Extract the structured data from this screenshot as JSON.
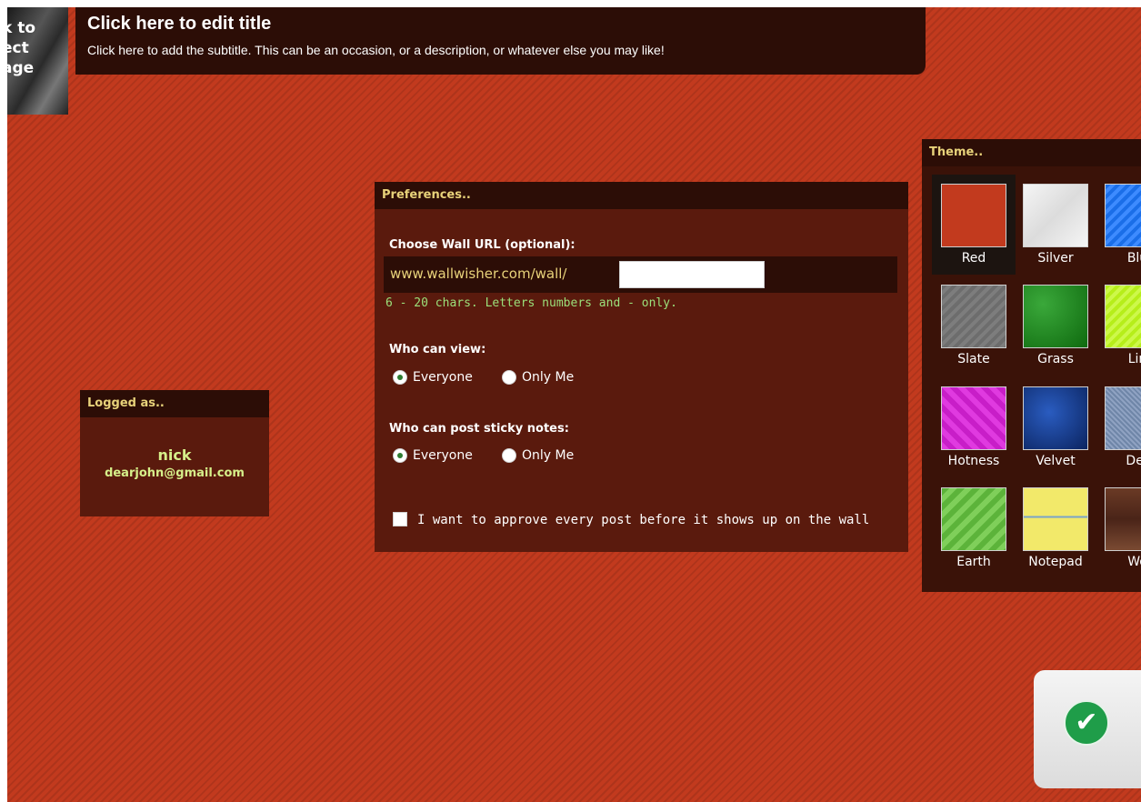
{
  "back_tile": {
    "lines": [
      "k to",
      "ect",
      "age"
    ]
  },
  "header": {
    "title": "Click here to edit title",
    "subtitle": "Click here to add the subtitle. This can be an occasion, or a description, or whatever else you may like!"
  },
  "logged": {
    "header": "Logged as..",
    "name": "nick",
    "email": "dearjohn@gmail.com"
  },
  "preferences": {
    "header": "Preferences..",
    "url_label": "Choose Wall URL (optional):",
    "url_prefix": "www.wallwisher.com/wall/",
    "url_value": "",
    "url_hint": "6 - 20 chars. Letters numbers and - only.",
    "view_label": "Who can view:",
    "view_options": [
      "Everyone",
      "Only Me"
    ],
    "view_selected": "Everyone",
    "post_label": "Who can post sticky notes:",
    "post_options": [
      "Everyone",
      "Only Me"
    ],
    "post_selected": "Everyone",
    "approve_label": "I want to approve every post before it shows up on the wall",
    "approve_checked": false
  },
  "theme": {
    "header": "Theme..",
    "selected": "Red",
    "tiles": [
      {
        "name": "Red",
        "color": "#c23a1e"
      },
      {
        "name": "Silver",
        "color": "#e8e8e8"
      },
      {
        "name": "Blu",
        "color": "#1a6ee8"
      },
      {
        "name": "Slate",
        "color": "#6d6d6d"
      },
      {
        "name": "Grass",
        "color": "#1f8a1f"
      },
      {
        "name": "Lin",
        "color": "#b6ee1a"
      },
      {
        "name": "Hotness",
        "color": "#e03ae0"
      },
      {
        "name": "Velvet",
        "color": "#123c8c"
      },
      {
        "name": "Der",
        "color": "#6f86a8"
      },
      {
        "name": "Earth",
        "color": "#5cb33a"
      },
      {
        "name": "Notepad",
        "color": "#f2e96a"
      },
      {
        "name": "Wo",
        "color": "#5a3020"
      }
    ]
  },
  "ok_button": {
    "icon": "checkmark-icon",
    "color": "#1f9d49"
  }
}
